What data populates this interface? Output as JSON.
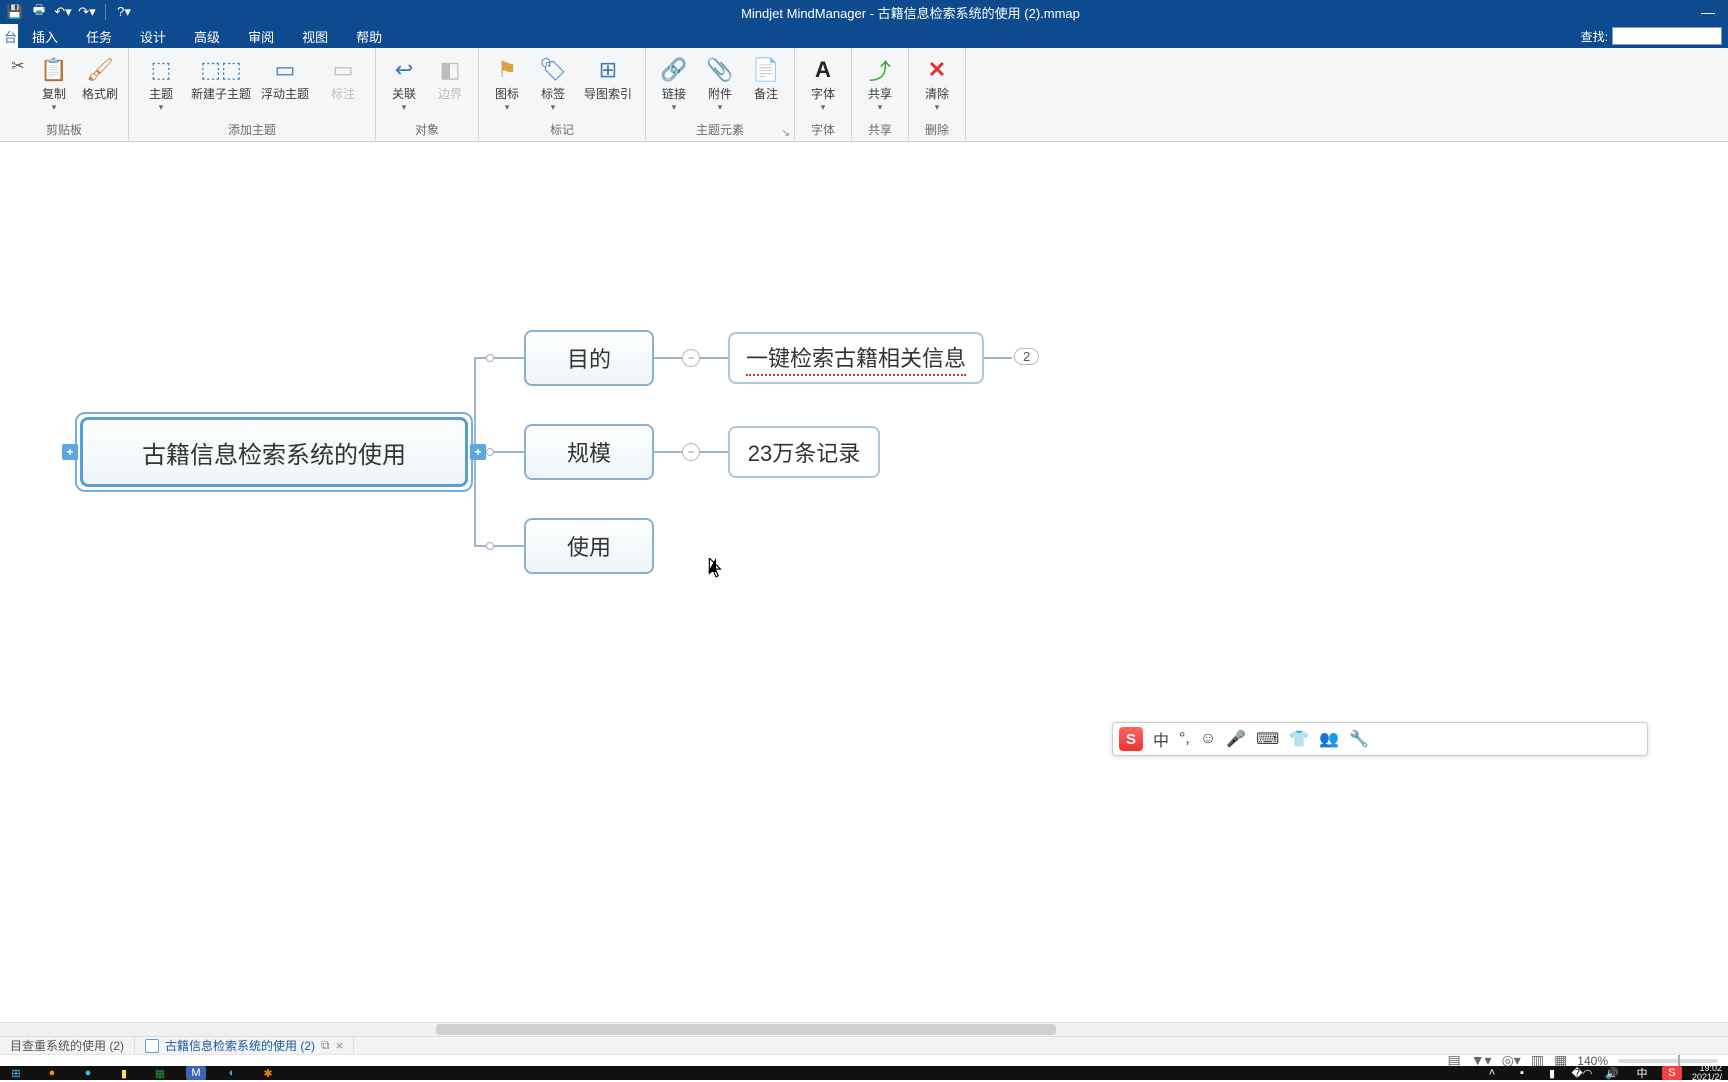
{
  "title": "Mindjet MindManager - 古籍信息检索系统的使用 (2).mmap",
  "menu": {
    "items": [
      "插入",
      "任务",
      "设计",
      "高级",
      "审阅",
      "视图",
      "帮助"
    ]
  },
  "search": {
    "label": "查找:"
  },
  "ribbon": {
    "groups": {
      "clipboard": {
        "label": "剪贴板",
        "copy": "复制",
        "format": "格式刷"
      },
      "addtopic": {
        "label": "添加主题",
        "topic": "主题",
        "subtopic": "新建子主题",
        "float": "浮动主题",
        "note": "标注"
      },
      "object": {
        "label": "对象",
        "relation": "关联",
        "boundary": "边界"
      },
      "tags": {
        "label": "标记",
        "icon": "图标",
        "tag": "标签",
        "index": "导图索引"
      },
      "elements": {
        "label": "主题元素",
        "link": "链接",
        "attach": "附件",
        "memo": "备注"
      },
      "font": {
        "label": "字体",
        "font": "字体"
      },
      "share": {
        "label": "共享",
        "share": "共享"
      },
      "delete": {
        "label": "删除",
        "clear": "清除"
      }
    }
  },
  "mindmap": {
    "central": "古籍信息检索系统的使用",
    "nodes": {
      "purpose": "目的",
      "purpose_child": "一键检索古籍相关信息",
      "purpose_badge": "2",
      "scale": "规模",
      "scale_child": "23万条记录",
      "usage": "使用"
    }
  },
  "doctabs": {
    "tab1": "目查重系统的使用 (2)",
    "tab2": "古籍信息检索系统的使用 (2)"
  },
  "zoom": "140%",
  "ime": {
    "lang": "中"
  },
  "clock": {
    "time": "19:02",
    "date": "2021/2/"
  }
}
